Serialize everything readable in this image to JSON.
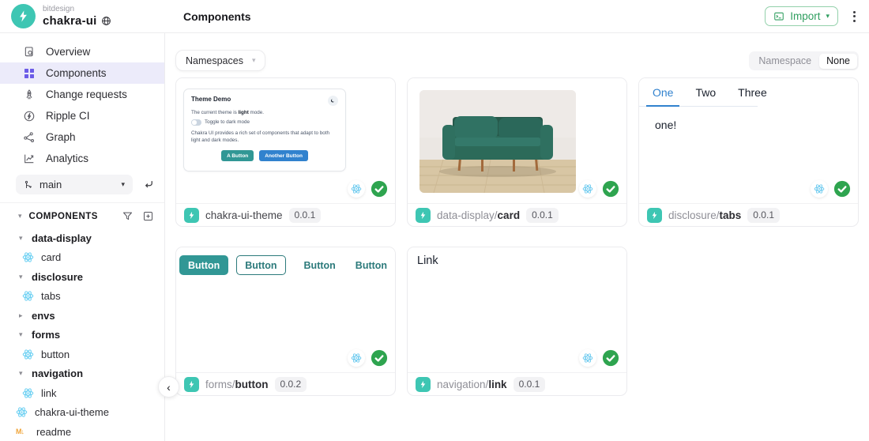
{
  "header": {
    "org": "bitdesign",
    "workspace": "chakra-ui",
    "page_title": "Components",
    "import_label": "Import"
  },
  "sidebar": {
    "nav": [
      {
        "label": "Overview"
      },
      {
        "label": "Components",
        "active": true
      },
      {
        "label": "Change requests"
      },
      {
        "label": "Ripple CI"
      },
      {
        "label": "Graph"
      },
      {
        "label": "Analytics"
      }
    ],
    "lane": {
      "value": "main"
    },
    "tree": {
      "header": "COMPONENTS",
      "items": [
        {
          "label": "data-display",
          "type": "folder",
          "expanded": true
        },
        {
          "label": "card",
          "type": "component"
        },
        {
          "label": "disclosure",
          "type": "folder",
          "expanded": true
        },
        {
          "label": "tabs",
          "type": "component"
        },
        {
          "label": "envs",
          "type": "folder",
          "expanded": false
        },
        {
          "label": "forms",
          "type": "folder",
          "expanded": true
        },
        {
          "label": "button",
          "type": "component"
        },
        {
          "label": "navigation",
          "type": "folder",
          "expanded": true
        },
        {
          "label": "link",
          "type": "component"
        },
        {
          "label": "chakra-ui-theme",
          "type": "component"
        },
        {
          "label": "readme",
          "type": "readme"
        }
      ]
    }
  },
  "toolbar": {
    "namespaces": "Namespaces",
    "namespace_label": "Namespace",
    "namespace_value": "None"
  },
  "cards": [
    {
      "namespace": "",
      "name": "chakra-ui-theme",
      "version": "0.0.1"
    },
    {
      "namespace": "data-display/",
      "name": "card",
      "version": "0.0.1"
    },
    {
      "namespace": "disclosure/",
      "name": "tabs",
      "version": "0.0.1"
    },
    {
      "namespace": "forms/",
      "name": "button",
      "version": "0.0.2"
    },
    {
      "namespace": "navigation/",
      "name": "link",
      "version": "0.0.1"
    }
  ],
  "previews": {
    "theme_demo": {
      "title": "Theme Demo",
      "line1_pre": "The current theme is ",
      "line1_bold": "light",
      "line1_post": " mode.",
      "toggle_label": "Toggle to dark mode",
      "body": "Chakra UI provides a rich set of components that adapt to both light and dark modes.",
      "button_a": "A Button",
      "button_b": "Another Button"
    },
    "tabs": {
      "items": [
        "One",
        "Two",
        "Three"
      ],
      "active": "One",
      "content": "one!"
    },
    "buttons": {
      "labels": [
        "Button",
        "Button",
        "Button",
        "Button"
      ]
    },
    "link": {
      "text": "Link"
    }
  },
  "colors": {
    "brand_teal": "#3EC6B3",
    "selected_purple": "#6C5CE7",
    "selected_purple_bg": "#ECEBFA",
    "import_green": "#2F9E5F",
    "success_green": "#2EA44F",
    "snowflake_cyan": "#6FCBEF",
    "tab_blue": "#3182CE",
    "chakra_teal": "#319795",
    "chakra_blue": "#3182CE"
  }
}
